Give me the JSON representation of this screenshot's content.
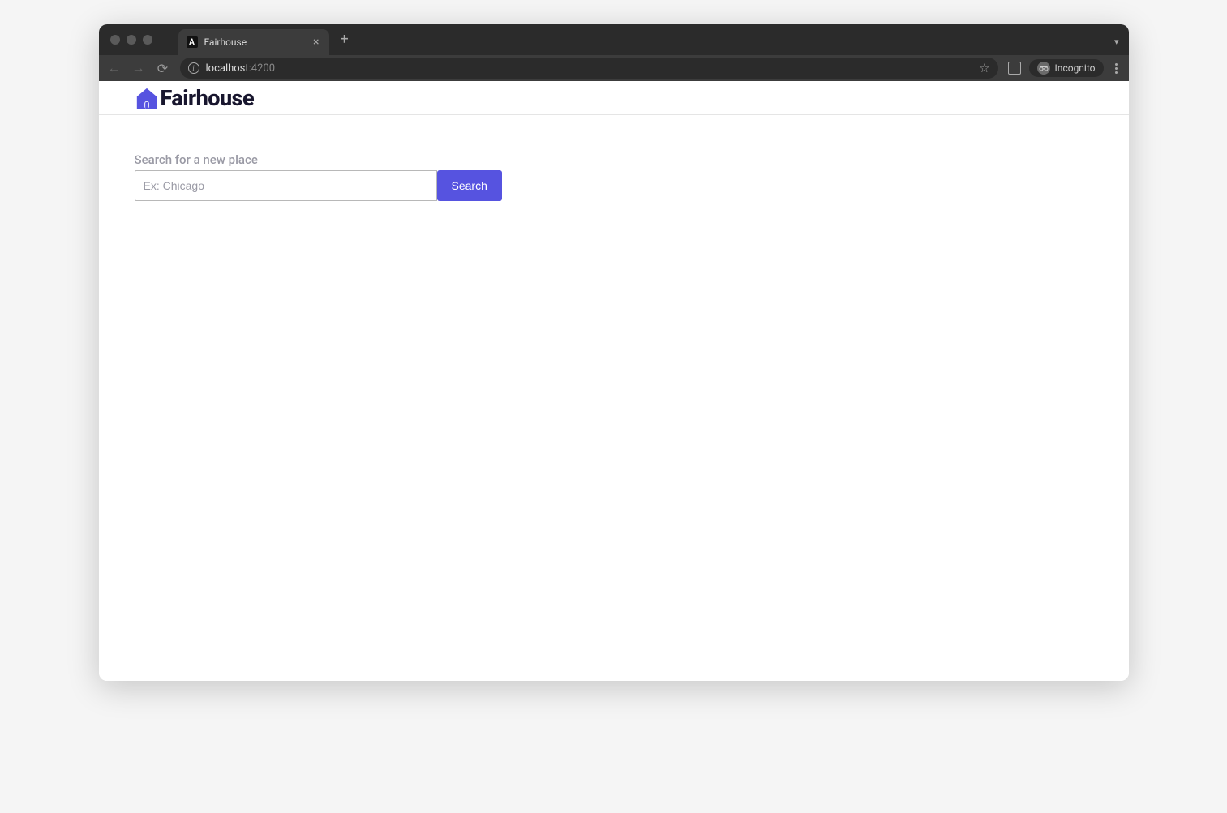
{
  "browser": {
    "tab": {
      "favicon_letter": "A",
      "title": "Fairhouse"
    },
    "url": {
      "host": "localhost",
      "port": ":4200"
    },
    "incognito_label": "Incognito"
  },
  "app": {
    "brand_name": "Fairhouse",
    "brand_color": "#5653e0"
  },
  "search": {
    "label": "Search for a new place",
    "placeholder": "Ex: Chicago",
    "value": "",
    "button_label": "Search"
  }
}
